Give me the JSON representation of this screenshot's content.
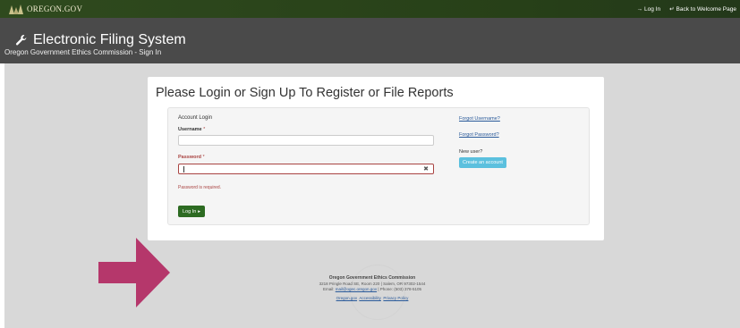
{
  "brand": {
    "logo_text": "OREGON.GOV"
  },
  "top_nav": {
    "login": "Log In",
    "back": "Back to Welcome Page"
  },
  "header": {
    "title": "Electronic Filing System",
    "subtitle": "Oregon Government Ethics Commission - Sign In"
  },
  "panel": {
    "title": "Please Login or Sign Up To Register or File Reports",
    "section": "Account Login",
    "username_label": "Username",
    "password_label": "Password",
    "required_mark": "*",
    "error_text": "Password is required.",
    "login_button": "Log In",
    "forgot_username": "Forgot Username?",
    "forgot_password": "Forgot Password?",
    "new_user": "New user?",
    "create_account": "Create an account"
  },
  "footer": {
    "org": "Oregon Government Ethics Commission",
    "address": "3218 Pringle Road SE, Room 220 | Salem, OR 97302-1544",
    "email_prefix": "Email:",
    "email": "mail@ogec.oregon.gov",
    "phone": "| Phone: (503) 378-5105",
    "links": [
      "Oregon.gov",
      "Accessibility",
      "Privacy Policy"
    ]
  },
  "colors": {
    "accent_green": "#2d6b22",
    "error_red": "#a94442",
    "info_blue": "#5bc0de",
    "arrow": "#b5376b"
  },
  "icons": {
    "tool": "wrench-icon",
    "login": "sign-in-icon",
    "back": "back-icon",
    "clear": "clear-x-icon",
    "caret": "caret-right-icon"
  }
}
